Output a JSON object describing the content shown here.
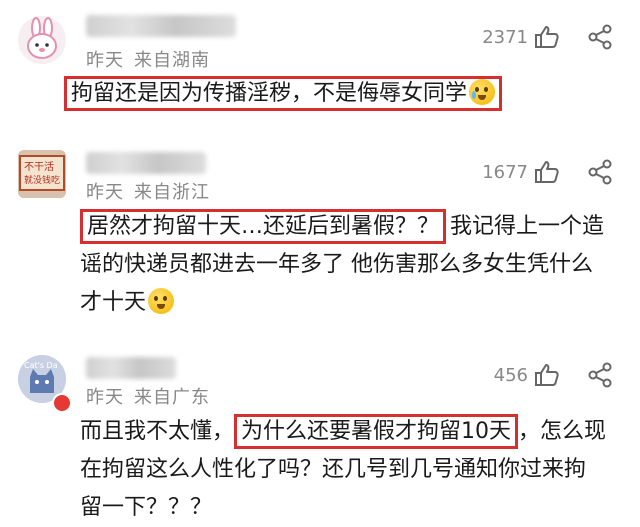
{
  "comments": [
    {
      "time": "昨天",
      "location": "来自湖南",
      "likes": "2371",
      "highlight": "拘留还是因为传播淫秽，不是侮辱女同学",
      "after": ""
    },
    {
      "time": "昨天",
      "location": "来自浙江",
      "likes": "1677",
      "avatar_text_1": "不干活",
      "avatar_text_2": "就没钱吃",
      "highlight": "居然才拘留十天…还延后到暑假？？",
      "line1_rest": "我记得上一个造",
      "line2": "谣的快递员都进去一年多了 他伤害那么多女生凭什么",
      "line3": "才十天"
    },
    {
      "time": "昨天",
      "location": "来自广东",
      "likes": "456",
      "avatar_text": "Cat's Da",
      "before": "而且我不太懂，",
      "highlight": "为什么还要暑假才拘留10天",
      "line1_rest": "，怎么现",
      "line2": "在拘留这么人性化了吗？还几号到几号通知你过来拘",
      "line3": "留一下？？？"
    }
  ],
  "icons": {
    "like": "thumbs-up-icon",
    "share": "share-icon"
  },
  "colors": {
    "highlight_border": "#d62f2f",
    "meta_text": "#888888"
  }
}
